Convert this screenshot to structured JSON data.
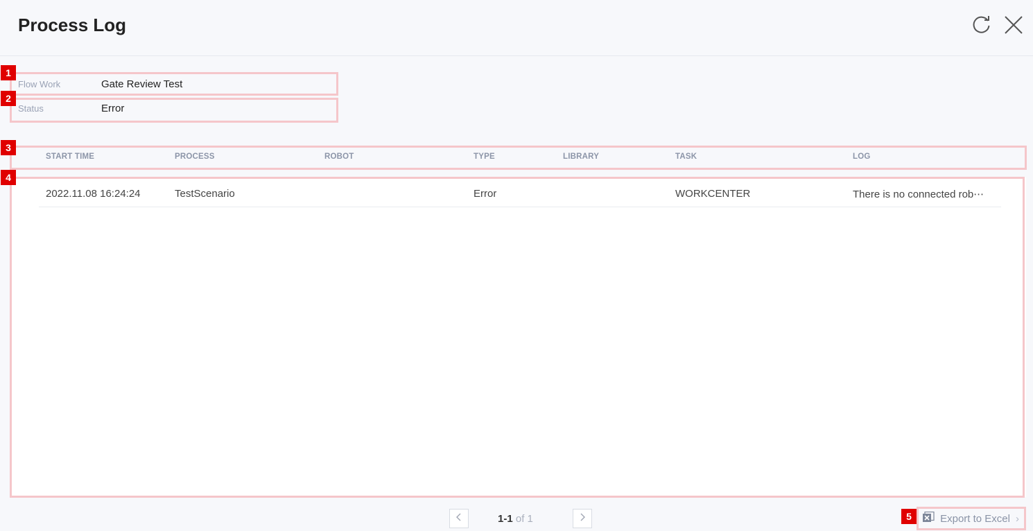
{
  "header": {
    "title": "Process Log",
    "refresh_icon": "refresh-icon",
    "close_icon": "close-icon"
  },
  "info": {
    "flow_work_label": "Flow Work",
    "flow_work_value": "Gate Review Test",
    "status_label": "Status",
    "status_value": "Error"
  },
  "columns": [
    "START TIME",
    "PROCESS",
    "ROBOT",
    "TYPE",
    "LIBRARY",
    "TASK",
    "LOG"
  ],
  "rows": [
    {
      "start_time": "2022.11.08 16:24:24",
      "process": "TestScenario",
      "robot": "",
      "type": "Error",
      "library": "",
      "task": "WORKCENTER",
      "log": "There is no connected rob⋯"
    }
  ],
  "pager": {
    "range": "1-1",
    "of_label": "of 1",
    "prev_icon": "chevron-left-icon",
    "next_icon": "chevron-right-icon"
  },
  "export": {
    "label": "Export to Excel",
    "icon": "excel-icon",
    "chevron": "›"
  },
  "annotations": [
    "1",
    "2",
    "3",
    "4",
    "5"
  ],
  "colors": {
    "marker": "#e00000",
    "callout_border": "#f5c6ca",
    "label": "#9aa2b5"
  }
}
